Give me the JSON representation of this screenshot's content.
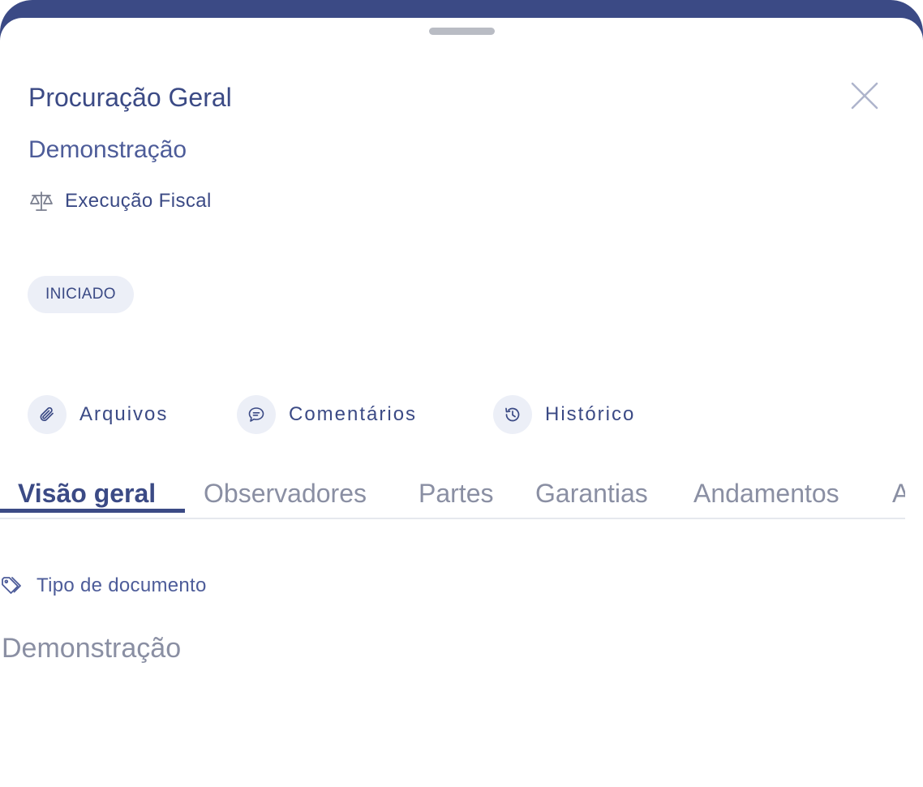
{
  "header": {
    "title": "Procuração Geral",
    "subtitle": "Demonstração",
    "process_type": "Execução Fiscal"
  },
  "status": {
    "label": "INICIADO"
  },
  "actions": [
    {
      "label": "Arquivos",
      "icon": "paperclip-icon"
    },
    {
      "label": "Comentários",
      "icon": "comment-icon"
    },
    {
      "label": "Histórico",
      "icon": "history-icon"
    }
  ],
  "tabs": [
    {
      "label": "Visão geral",
      "active": true
    },
    {
      "label": "Observadores",
      "active": false
    },
    {
      "label": "Partes",
      "active": false
    },
    {
      "label": "Garantias",
      "active": false
    },
    {
      "label": "Andamentos",
      "active": false
    },
    {
      "label": "A",
      "active": false
    }
  ],
  "overview": {
    "document_type_label": "Tipo de documento",
    "document_type_value": "Demonstração"
  },
  "colors": {
    "primary": "#3b4a85",
    "badge_bg": "#eceff7",
    "muted_text": "#8a8fa3"
  }
}
